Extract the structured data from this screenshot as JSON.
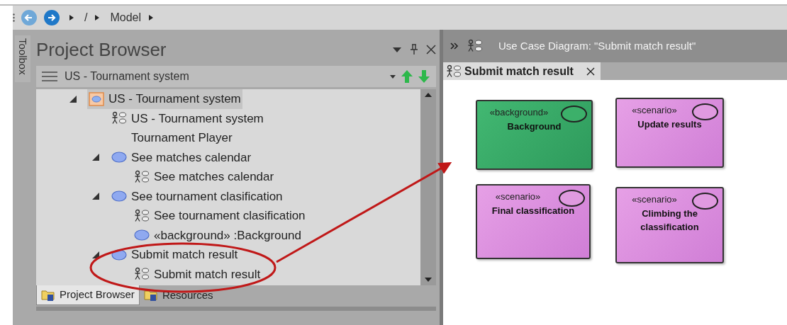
{
  "breadcrumb": {
    "items": [
      "/",
      "Model"
    ]
  },
  "toolbox": {
    "label": "Toolbox"
  },
  "project_browser": {
    "title": "Project Browser",
    "package": "US - Tournament system",
    "tree": [
      {
        "kind": "package",
        "label": "US - Tournament system",
        "expanded": true,
        "selected": true,
        "children": [
          {
            "kind": "diagram",
            "label": "US - Tournament system",
            "selected": false
          },
          {
            "kind": "actor",
            "label": "Tournament Player",
            "selected": false
          },
          {
            "kind": "usecase",
            "label": "See matches calendar",
            "expanded": true,
            "selected": false,
            "children": [
              {
                "kind": "diagram",
                "label": "See matches calendar",
                "selected": false
              }
            ]
          },
          {
            "kind": "usecase",
            "label": "See tournament clasification",
            "expanded": true,
            "selected": false,
            "children": [
              {
                "kind": "diagram",
                "label": "See tournament clasification",
                "selected": false
              },
              {
                "kind": "usecase",
                "label": "«background» :Background",
                "selected": false
              }
            ]
          },
          {
            "kind": "usecase",
            "label": "Submit match result",
            "expanded": true,
            "selected": false,
            "children": [
              {
                "kind": "diagram",
                "label": "Submit match result",
                "selected": false
              }
            ]
          }
        ]
      }
    ],
    "tabs": [
      {
        "label": "Project Browser",
        "selected": true
      },
      {
        "label": "Resources",
        "selected": false
      }
    ]
  },
  "diagram": {
    "header": "Use Case Diagram: \"Submit match result\"",
    "tab": {
      "label": "Submit match result"
    },
    "elements": [
      {
        "kind": "background",
        "stereotype": "«background»",
        "name": "Background"
      },
      {
        "kind": "scenario",
        "stereotype": "«scenario»",
        "name": "Update results"
      },
      {
        "kind": "scenario",
        "stereotype": "«scenario»",
        "name": "Final classification"
      },
      {
        "kind": "scenario",
        "stereotype": "«scenario»",
        "name": "Climbing the classification"
      }
    ]
  }
}
